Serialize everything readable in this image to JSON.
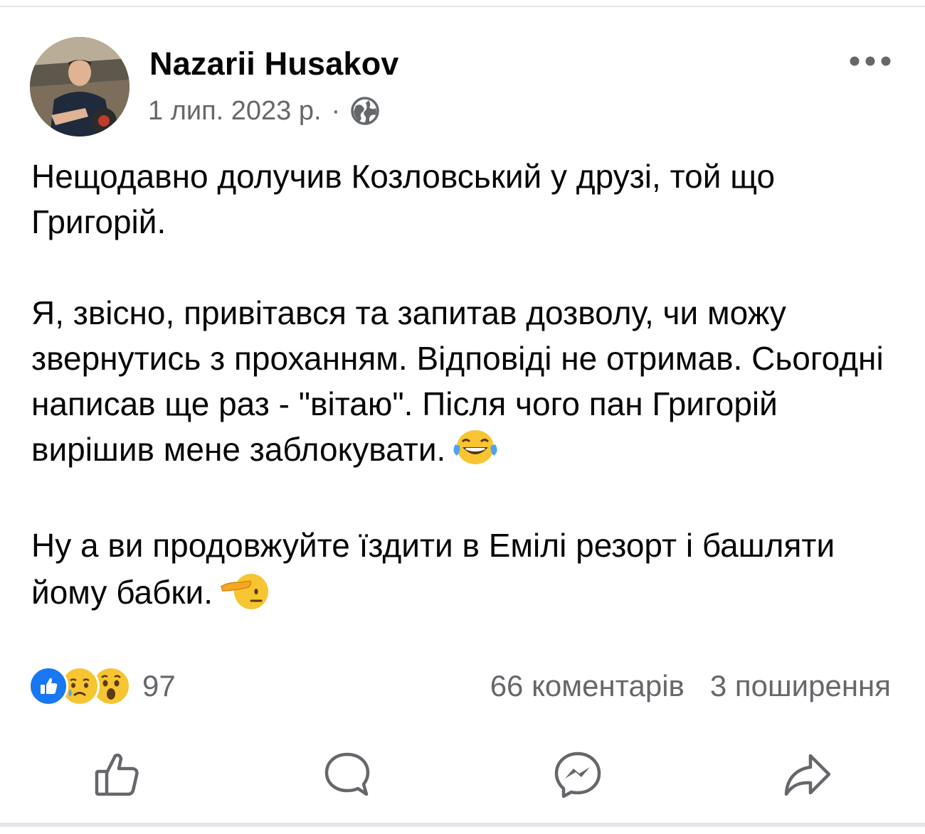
{
  "post": {
    "author": "Nazarii Husakov",
    "date": "1 лип. 2023 р.",
    "separator": "·",
    "audience_icon": "globe-icon",
    "more_icon": "more-horizontal-icon",
    "paragraphs": [
      "Нещодавно долучив Козловський у друзі, той що Григорій.",
      "Я, звісно, привітався та запитав дозволу, чи можу звернутись з проханням. Відповіді не отримав. Сьогодні написав ще раз - \"вітаю\". Після чого пан Григорій вирішив мене заблокувати.",
      "Ну а ви продовжуйте їздити в Емілі резорт і башляти йому бабки."
    ],
    "emojis": [
      "face-with-tears-of-joy",
      "saluting-face"
    ]
  },
  "stats": {
    "reaction_icons": [
      "like-icon",
      "sad-icon",
      "wow-icon"
    ],
    "reaction_count": "97",
    "comments": "66 коментарів",
    "shares": "3 поширення"
  },
  "actions": {
    "icons": [
      "like-outline-icon",
      "comment-icon",
      "messenger-icon",
      "share-icon"
    ]
  },
  "colors": {
    "text": "#050505",
    "secondary": "#65676b",
    "like_blue": "#1877f2",
    "emoji_yellow": "#f7c531",
    "divider": "#e4e6eb"
  }
}
